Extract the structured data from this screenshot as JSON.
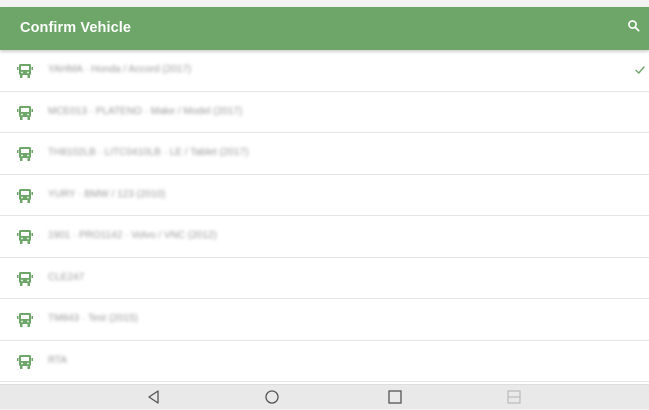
{
  "appbar": {
    "title": "Confirm Vehicle",
    "color": "#6da668"
  },
  "icons": {
    "search": "search-icon",
    "row": "bus-icon",
    "selected": "checkmark-icon",
    "nav": [
      "back-icon",
      "home-icon",
      "recents-icon",
      "split-screen-icon"
    ]
  },
  "vehicles": [
    {
      "label": "YAHMA · Honda / Accord (2017)",
      "selected": true
    },
    {
      "label": "MCE013 · PLATENO · Make / Model (2017)",
      "selected": false
    },
    {
      "label": "TH8102LB · LITC0410LB · LE / Tablet (2017)",
      "selected": false
    },
    {
      "label": "YURY · BMW / 123 (2010)",
      "selected": false
    },
    {
      "label": "1901 · PRO1142 · Volvo / VNC (2012)",
      "selected": false
    },
    {
      "label": "CLE247",
      "selected": false
    },
    {
      "label": "TM843 · Test (2015)",
      "selected": false
    },
    {
      "label": "RTA",
      "selected": false
    }
  ]
}
